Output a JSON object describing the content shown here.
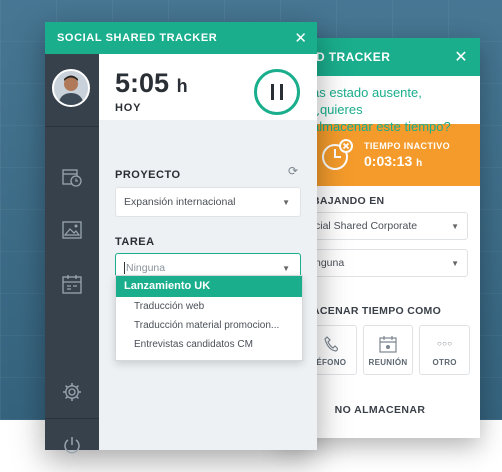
{
  "colors": {
    "accent": "#1aae8d",
    "alert": "#f49b2b",
    "sidebar": "#36414c",
    "panel": "#eef1f3"
  },
  "front": {
    "title": "SOCIAL SHARED TRACKER",
    "close_icon": "close-icon",
    "timer": {
      "time": "5:05",
      "unit": "h",
      "label": "HOY"
    },
    "project": {
      "label": "PROYECTO",
      "value": "Expansión internacional"
    },
    "task": {
      "label": "TAREA",
      "value": "Ninguna"
    },
    "dropdown": [
      "Lanzamiento UK",
      "Traducción web",
      "Traducción material promocion...",
      "Entrevistas candidatos CM"
    ],
    "sidebar_icons": [
      "avatar",
      "timesheet-icon",
      "image-icon",
      "calendar-icon",
      "settings-icon",
      "power-icon"
    ]
  },
  "back": {
    "title": "D TRACKER",
    "alert_line1": "as estado ausente, ¿quieres",
    "alert_line2": "almacenar este tiempo?",
    "idle_label": "TIEMPO INACTIVO",
    "idle_time": "0:03:13",
    "idle_unit": "h",
    "working_label": "BAJANDO EN",
    "working_value": "cial Shared Corporate",
    "task_value": "nguna",
    "store_label": "ACENAR TIEMPO COMO",
    "options": [
      "ÉFONO",
      "REUNIÓN",
      "OTRO"
    ],
    "no_store": "NO ALMACENAR"
  }
}
